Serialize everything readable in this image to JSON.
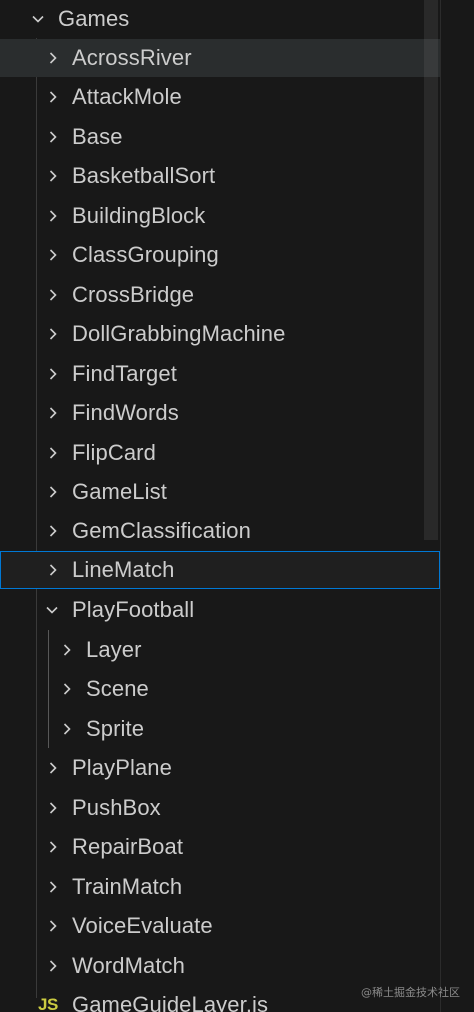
{
  "explorer": {
    "root_folder": "Games",
    "folders": [
      {
        "label": "AcrossRiver"
      },
      {
        "label": "AttackMole"
      },
      {
        "label": "Base"
      },
      {
        "label": "BasketballSort"
      },
      {
        "label": "BuildingBlock"
      },
      {
        "label": "ClassGrouping"
      },
      {
        "label": "CrossBridge"
      },
      {
        "label": "DollGrabbingMachine"
      },
      {
        "label": "FindTarget"
      },
      {
        "label": "FindWords"
      },
      {
        "label": "FlipCard"
      },
      {
        "label": "GameList"
      },
      {
        "label": "GemClassification"
      },
      {
        "label": "LineMatch"
      },
      {
        "label": "PlayFootball"
      },
      {
        "label": "PlayPlane"
      },
      {
        "label": "PushBox"
      },
      {
        "label": "RepairBoat"
      },
      {
        "label": "TrainMatch"
      },
      {
        "label": "VoiceEvaluate"
      },
      {
        "label": "WordMatch"
      }
    ],
    "playfootball_children": [
      {
        "label": "Layer"
      },
      {
        "label": "Scene"
      },
      {
        "label": "Sprite"
      }
    ],
    "file": {
      "icon_text": "JS",
      "label": "GameGuideLayer.js"
    },
    "hovered": "AcrossRiver",
    "selected": "LineMatch",
    "expanded": [
      "Games",
      "PlayFootball"
    ],
    "colors": {
      "background": "#181818",
      "text": "#cccccc",
      "selection_border": "#0078d4",
      "hover_background": "#2a2d2e",
      "js_icon": "#cbcb41"
    }
  },
  "watermark": "@稀土掘金技术社区"
}
